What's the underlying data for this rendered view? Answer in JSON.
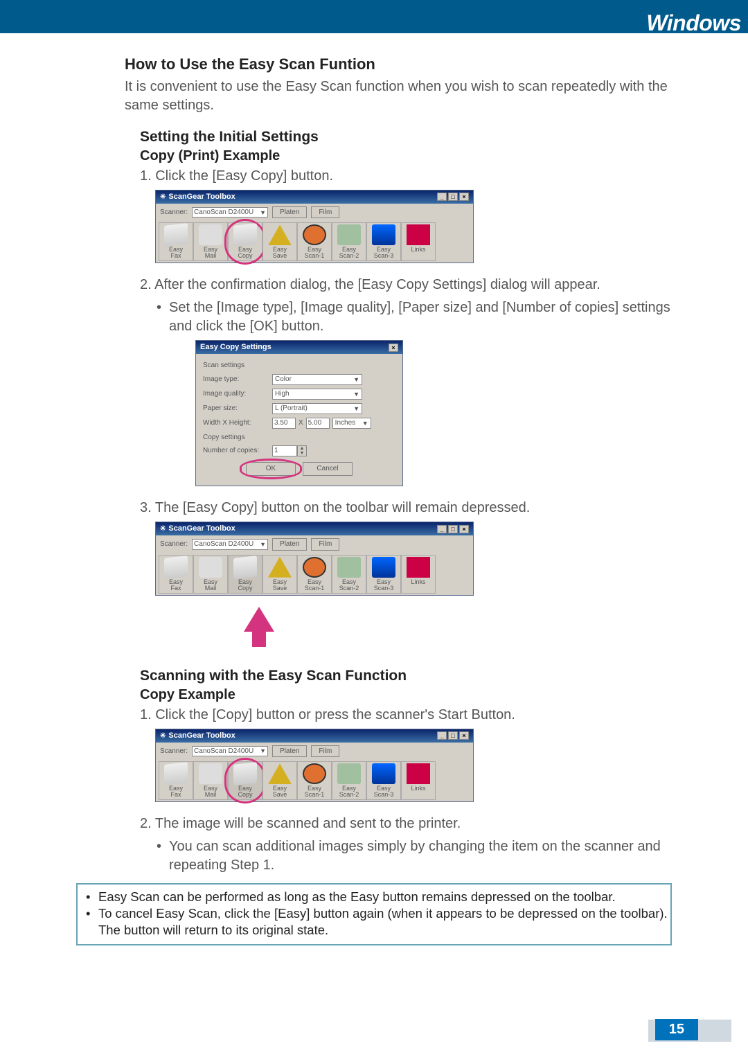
{
  "header": {
    "platform_label": "Windows"
  },
  "section1": {
    "title": "How to Use the Easy Scan Funtion",
    "intro": "It is convenient to use the Easy Scan function when you wish to scan repeatedly with the same settings.",
    "sub_title": "Setting the Initial Settings",
    "example_label": "Copy (Print) Example",
    "step1": "1. Click the [Easy Copy] button.",
    "step2": "2. After the confirmation dialog, the [Easy Copy Settings] dialog will appear.",
    "step2_bullet": "Set the [Image type], [Image quality], [Paper size] and [Number of copies] settings and click the [OK] button.",
    "step3": "3. The [Easy Copy] button on the toolbar will remain depressed."
  },
  "section2": {
    "title": "Scanning with the Easy Scan Function",
    "example_label": "Copy Example",
    "step1": "1. Click the [Copy] button or press the scanner's Start Button.",
    "step2": "2. The image will be scanned and sent to the printer.",
    "bullet": "You can scan additional images simply by changing the item on the scanner and repeating Step 1."
  },
  "notes": {
    "n1": "Easy Scan can be performed as long as the Easy button remains depressed on the toolbar.",
    "n2": "To cancel Easy Scan, click the [Easy] button again (when it appears to be depressed on the toolbar). The button will return to its original state."
  },
  "toolbox": {
    "title": "ScanGear Toolbox",
    "scanner_label": "Scanner:",
    "scanner_value": "CanoScan D2400U",
    "tab_platen": "Platen",
    "tab_film": "Film",
    "buttons": {
      "fax": {
        "l1": "Easy",
        "l2": "Fax"
      },
      "mail": {
        "l1": "Easy",
        "l2": "Mail"
      },
      "copy": {
        "l1": "Easy",
        "l2": "Copy"
      },
      "save": {
        "l1": "Easy",
        "l2": "Save"
      },
      "scan1": {
        "l1": "Easy",
        "l2": "Scan-1"
      },
      "scan2": {
        "l1": "Easy",
        "l2": "Scan-2"
      },
      "scan3": {
        "l1": "Easy",
        "l2": "Scan-3"
      },
      "links": {
        "l1": "Links",
        "l2": ""
      }
    }
  },
  "ecs": {
    "title": "Easy Copy Settings",
    "scan_group": "Scan settings",
    "image_type_label": "Image type:",
    "image_type_value": "Color",
    "image_quality_label": "Image quality:",
    "image_quality_value": "High",
    "paper_size_label": "Paper size:",
    "paper_size_value": "L (Portrait)",
    "wh_label": "Width X Height:",
    "wh_w": "3.50",
    "wh_x": "X",
    "wh_h": "5.00",
    "wh_units": "Inches",
    "copy_group": "Copy settings",
    "copies_label": "Number of copies:",
    "copies_value": "1",
    "ok": "OK",
    "cancel": "Cancel"
  },
  "page_number": "15"
}
